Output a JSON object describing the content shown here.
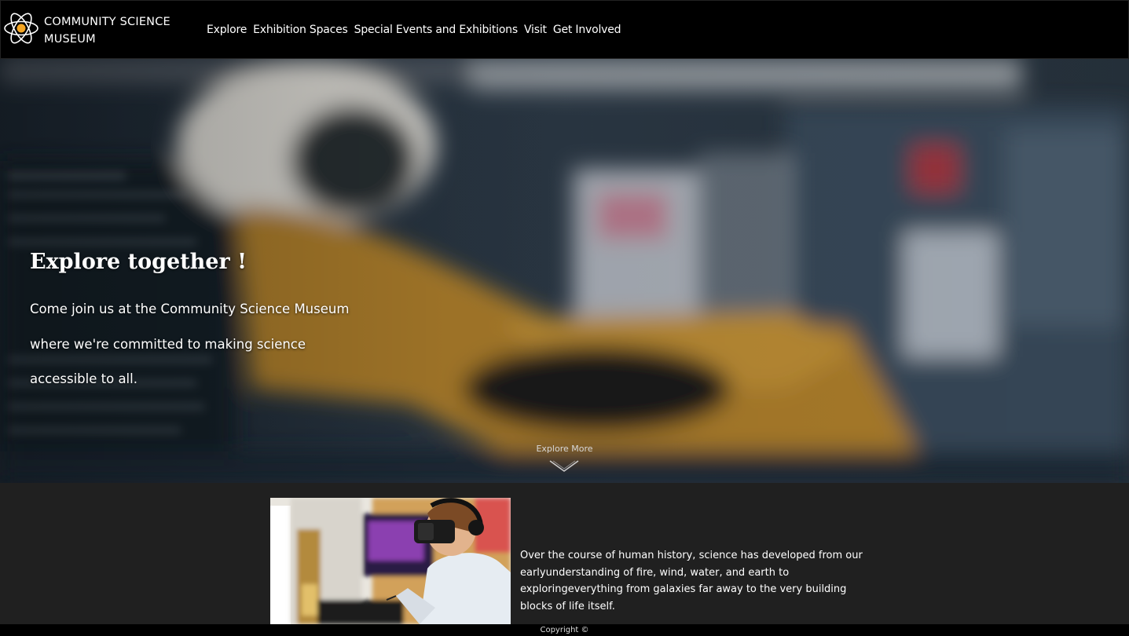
{
  "brand": {
    "name": "COMMUNITY SCIENCE MUSEUM",
    "logo_icon": "atom-icon",
    "accent": "#f5a623"
  },
  "nav": {
    "items": [
      {
        "label": "Explore"
      },
      {
        "label": "Exhibition Spaces"
      },
      {
        "label": "Special Events and Exhibitions"
      },
      {
        "label": "Visit"
      },
      {
        "label": "Get Involved"
      }
    ]
  },
  "hero": {
    "title": "Explore together !",
    "body": "Come join us at the Community Science Museum where we're committed to making science accessible to all.",
    "explore_more": "Explore More",
    "chevron_icon": "chevron-down-icon"
  },
  "feature": {
    "text": "Over the course of human history, science has developed from our earlyunderstanding of fire, wind, water, and earth to exploringeverything from galaxies far away to the very building blocks of life itself."
  },
  "footer": {
    "copyright": "Copyright ©"
  },
  "colors": {
    "header_bg": "#000000",
    "content_bg": "#202020",
    "footer_bg": "#000000",
    "text": "#ffffff"
  }
}
